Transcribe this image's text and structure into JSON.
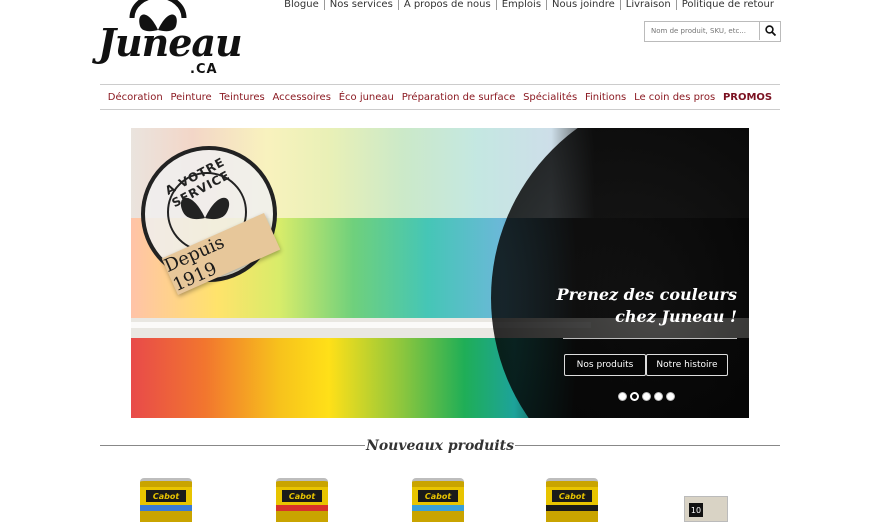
{
  "logo": {
    "word": "Juneau",
    "suffix": ".CA"
  },
  "toplinks": [
    "Blogue",
    "Nos services",
    "À propos de nous",
    "Emplois",
    "Nous joindre",
    "Livraison",
    "Politique de retour"
  ],
  "search": {
    "placeholder": "Nom de produit, SKU, etc..."
  },
  "nav": [
    "Décoration",
    "Peinture",
    "Teintures",
    "Accessoires",
    "Éco juneau",
    "Préparation de surface",
    "Spécialités",
    "Finitions",
    "Le coin des pros",
    "PROMOS"
  ],
  "banner": {
    "stamp_text": "A VOTRE SERVICE",
    "ribbon_text": "Depuis 1919",
    "slogan_line1": "Prenez des couleurs",
    "slogan_line2": "chez Juneau !",
    "btn_products": "Nos produits",
    "btn_history": "Notre histoire",
    "slide_count": 5,
    "active_slide": 2
  },
  "section_title": "Nouveaux produits",
  "products": [
    {
      "brand": "Cabot",
      "stripe_color": "#3a7bd5"
    },
    {
      "brand": "Cabot",
      "stripe_color": "#d8322a"
    },
    {
      "brand": "Cabot",
      "stripe_color": "#3aa0d8"
    },
    {
      "brand": "Cabot",
      "stripe_color": "#1a1a1a"
    },
    {
      "brand": "",
      "number": "10"
    }
  ]
}
